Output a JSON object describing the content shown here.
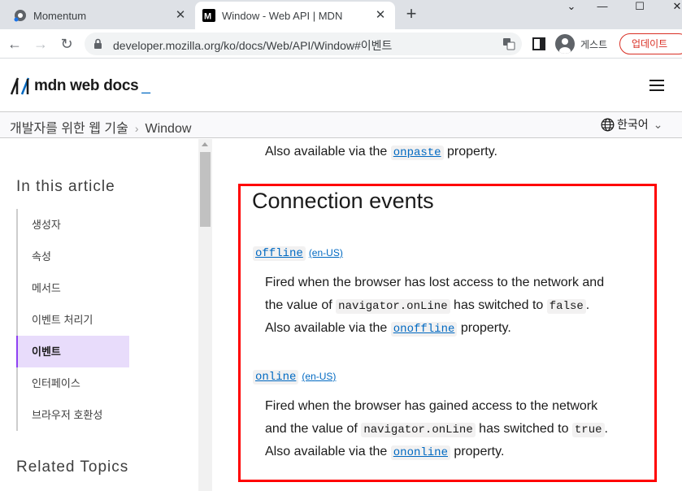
{
  "browser": {
    "tabs": [
      {
        "title": "Momentum",
        "active": false
      },
      {
        "title": "Window - Web API | MDN",
        "active": true
      }
    ],
    "url": "developer.mozilla.org/ko/docs/Web/API/Window#이벤트",
    "profile_label": "게스트",
    "update_label": "업데이트",
    "colors": {
      "tabstrip": "#dee1e6",
      "update": "#d93025"
    }
  },
  "mdn": {
    "logo_text": "mdn web docs",
    "breadcrumb": [
      "개발자를 위한 웹 기술",
      "Window"
    ],
    "language": "한국어"
  },
  "sidebar": {
    "toc_title": "In this article",
    "items": [
      {
        "label": "생성자",
        "active": false
      },
      {
        "label": "속성",
        "active": false
      },
      {
        "label": "메서드",
        "active": false
      },
      {
        "label": "이벤트 처리기",
        "active": false
      },
      {
        "label": "이벤트",
        "active": true
      },
      {
        "label": "인터페이스",
        "active": false
      },
      {
        "label": "브라우저 호환성",
        "active": false
      }
    ],
    "related_title": "Related Topics"
  },
  "content": {
    "top_line": {
      "before": "Also available via the ",
      "link": "onpaste",
      "after": " property."
    },
    "section_title": "Connection events",
    "events": [
      {
        "name": "offline",
        "en_us": "(en-US)",
        "line1": "Fired when the browser has lost access to the network and",
        "line2_a": "the value of ",
        "line2_code": "navigator.onLine",
        "line2_b": " has switched to ",
        "line2_val": "false",
        "line2_c": ".",
        "line3_a": "Also available via the ",
        "line3_link": "onoffline",
        "line3_b": " property."
      },
      {
        "name": "online",
        "en_us": "(en-US)",
        "line1": "Fired when the browser has gained access to the network",
        "line2_a": "and the value of ",
        "line2_code": "navigator.onLine",
        "line2_b": " has switched to ",
        "line2_val": "true",
        "line2_c": ".",
        "line3_a": "Also available via the ",
        "line3_link": "ononline",
        "line3_b": " property."
      }
    ],
    "highlight_color": "#ff0000"
  }
}
